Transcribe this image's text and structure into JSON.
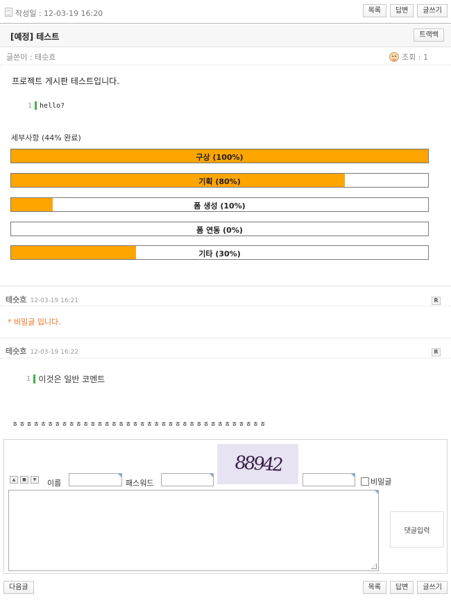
{
  "header": {
    "date_label": "작성일 : 12-03-19 16:20",
    "buttons": {
      "list": "목록",
      "reply": "답변",
      "write": "글쓰기"
    }
  },
  "post": {
    "title": "[예정] 테스트",
    "trackback": "트랙백",
    "author_label": "글쓴이 : 테슷흐",
    "views_label": "조회 : 1",
    "body": "프로젝트 게시판 테스트입니다.",
    "code": {
      "line_no": "1",
      "text": "hello?"
    }
  },
  "details": {
    "label": "세부사항 (44% 완료)",
    "items": [
      {
        "label": "구상 (100%)",
        "percent": 100
      },
      {
        "label": "기획 (80%)",
        "percent": 80
      },
      {
        "label": "폼 생성 (10%)",
        "percent": 10
      },
      {
        "label": "폼 연동 (0%)",
        "percent": 0
      },
      {
        "label": "기타 (30%)",
        "percent": 30
      }
    ]
  },
  "comments": [
    {
      "name": "테슷흐",
      "time": "12-03-19 16:21",
      "r": "R",
      "secret_text": "* 비밀글 입니다."
    },
    {
      "name": "테슷흐",
      "time": "12-03-19 16:22",
      "r": "R",
      "line_no": "1",
      "text": "이것은 일반 코멘트"
    }
  ],
  "tilde_text": "ㅎㅎㅎㅎㅎㅎㅎㅎㅎㅎㅎㅎㅎㅎㅎㅎㅎㅎㅎㅎㅎㅎㅎㅎㅎㅎㅎㅎㅎㅎㅎㅎㅎㅎㅎㅎ",
  "form": {
    "name_label": "이름",
    "password_label": "패스워드",
    "captcha": "88942",
    "secret_label": "비밀글",
    "submit": "댓글입력",
    "arrow_up": "▲",
    "arrow_mid": "■",
    "arrow_down": "▼"
  },
  "footer": {
    "next": "다음글",
    "list": "목록",
    "reply": "답변",
    "write": "글쓰기"
  },
  "colors": {
    "progress_fill": "#ffa500",
    "code_bar": "#3bb54a",
    "secret_text": "#f07020"
  }
}
